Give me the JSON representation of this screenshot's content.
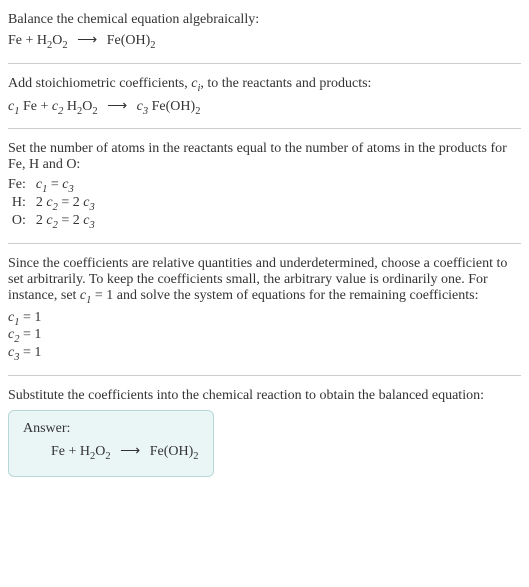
{
  "section1": {
    "intro": "Balance the chemical equation algebraically:"
  },
  "section2": {
    "text": "Add stoichiometric coefficients, ",
    "text2": ", to the reactants and products:"
  },
  "section3": {
    "text": "Set the number of atoms in the reactants equal to the number of atoms in the products for Fe, H and O:",
    "rows": [
      {
        "label": "Fe:"
      },
      {
        "label": "H:"
      },
      {
        "label": "O:"
      }
    ]
  },
  "section4": {
    "text1": "Since the coefficients are relative quantities and underdetermined, choose a coefficient to set arbitrarily. To keep the coefficients small, the arbitrary value is ordinarily one. For instance, set ",
    "text2": " = 1 and solve the system of equations for the remaining coefficients:",
    "coeffs": [
      " = 1",
      " = 1",
      " = 1"
    ]
  },
  "section5": {
    "text": "Substitute the coefficients into the chemical reaction to obtain the balanced equation:",
    "answer_label": "Answer:"
  },
  "chem": {
    "Fe": "Fe",
    "plus": " + ",
    "H": "H",
    "O": "O",
    "two": "2",
    "arrow": "⟶",
    "FeOH": "Fe(OH)",
    "c": "c",
    "i": "i",
    "one": "1",
    "three": "3",
    "eq": " = ",
    "twoc": "2 ",
    "space": " "
  },
  "chart_data": {
    "type": "table",
    "title": "Atom balance equations",
    "categories": [
      "Fe",
      "H",
      "O"
    ],
    "equations": [
      "c1 = c3",
      "2 c2 = 2 c3",
      "2 c2 = 2 c3"
    ],
    "solution": {
      "c1": 1,
      "c2": 1,
      "c3": 1
    }
  }
}
